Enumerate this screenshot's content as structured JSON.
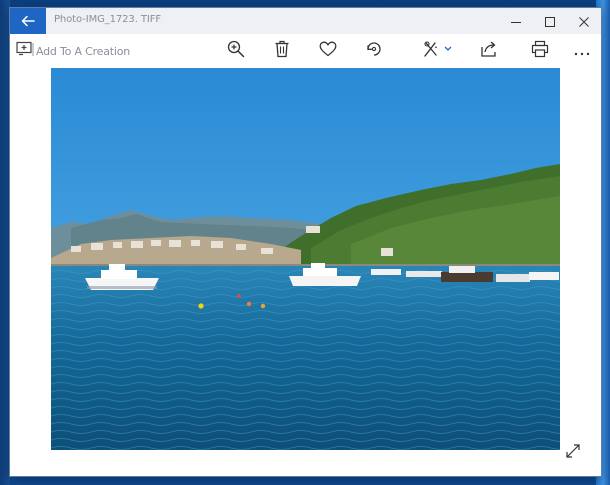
{
  "window": {
    "title": "Photo-IMG_1723. TIFF"
  },
  "toolbar": {
    "add_to_creation_label": "Add To A Creation",
    "buttons": [
      {
        "name": "zoom",
        "icon": "zoom-in-icon"
      },
      {
        "name": "delete",
        "icon": "trash-icon"
      },
      {
        "name": "favorite",
        "icon": "heart-icon"
      },
      {
        "name": "rotate",
        "icon": "rotate-icon"
      },
      {
        "name": "edit",
        "icon": "edit-tools-icon"
      },
      {
        "name": "share",
        "icon": "share-icon"
      },
      {
        "name": "print",
        "icon": "print-icon"
      },
      {
        "name": "more",
        "icon": "more-icon"
      }
    ]
  },
  "colors": {
    "accent": "#1f66c4",
    "titlebar": "#eef0f4",
    "sky": "#2b8fd8",
    "sea": "#13608f"
  },
  "photo": {
    "subject": "harbor-with-boats-and-green-hills"
  }
}
